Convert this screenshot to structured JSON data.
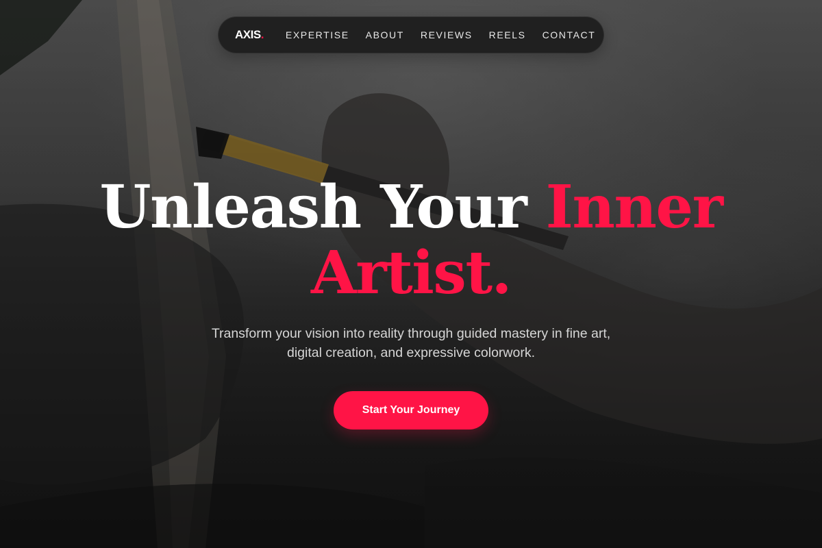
{
  "brand": {
    "logo_text": "AXIS",
    "logo_dot": ".",
    "accent_color": "#ff1446"
  },
  "nav": {
    "links": [
      "EXPERTISE",
      "ABOUT",
      "REVIEWS",
      "REELS",
      "CONTACT"
    ]
  },
  "hero": {
    "headline_part1": "Unleash Your ",
    "headline_accent_1": "Inner",
    "headline_accent_2": "Artist.",
    "subtitle_line1": "Transform your vision into reality through guided mastery in fine art,",
    "subtitle_line2": "digital creation, and expressive colorwork.",
    "cta_label": "Start Your Journey"
  },
  "background": {
    "image_subject": "hand-painting-canvas-photo"
  }
}
